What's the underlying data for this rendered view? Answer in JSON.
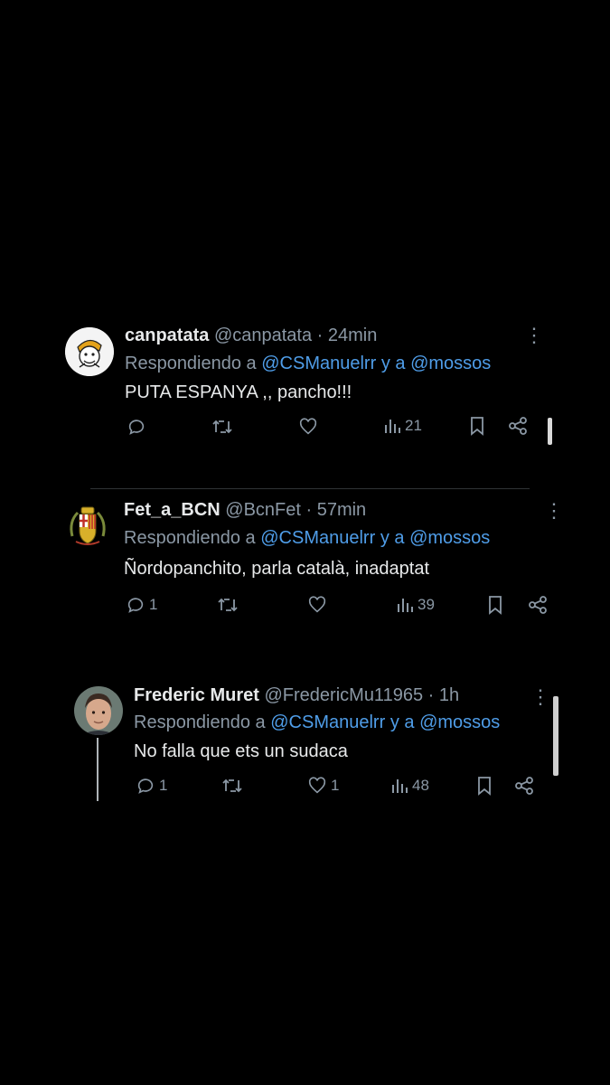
{
  "tweets": [
    {
      "name": "canpatata",
      "meta": "@canpatata · 24min",
      "reply_prefix": "Respondiendo a",
      "mention1": "@CSManuelrr",
      "reply_mid": "y a",
      "mention2": "@mossos",
      "text": "PUTA ESPANYA ,, pancho!!!",
      "replies": "",
      "retweets": "",
      "likes": "",
      "views": "21"
    },
    {
      "name": "Fet_a_BCN",
      "meta": "@BcnFet · 57min",
      "reply_prefix": "Respondiendo a",
      "mention1": "@CSManuelrr",
      "reply_mid": "y a",
      "mention2": "@mossos",
      "text": "Ñordopanchito, parla català, inadaptat",
      "replies": "1",
      "retweets": "",
      "likes": "",
      "views": "39"
    },
    {
      "name": "Frederic Muret",
      "meta": "@FredericMu11965 · 1h",
      "reply_prefix": "Respondiendo a",
      "mention1": "@CSManuelrr",
      "reply_mid": "y a",
      "mention2": "@mossos",
      "text": "No falla que ets un sudaca",
      "replies": "1",
      "retweets": "",
      "likes": "1",
      "views": "48"
    }
  ],
  "colors": {
    "background": "#000000",
    "text": "#e7e9ea",
    "muted": "#8b98a5",
    "mention": "#4f9de8"
  },
  "icons": [
    "reply-icon",
    "retweet-icon",
    "like-icon",
    "views-icon",
    "bookmark-icon",
    "share-icon",
    "more-icon"
  ]
}
